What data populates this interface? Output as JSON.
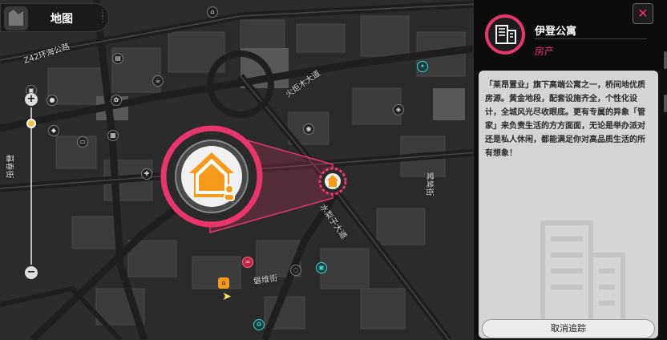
{
  "header": {
    "title": "地图"
  },
  "streets": [
    {
      "name": "Z42环海公路"
    },
    {
      "name": "火炬木大道"
    },
    {
      "name": "水梨子大道"
    },
    {
      "name": "磐维街"
    },
    {
      "name": "鹭鸶街"
    },
    {
      "name": "暮春街"
    }
  ],
  "selected_marker": {
    "icon": "house-icon",
    "accent": "#e8356c",
    "fill": "#f79a1b"
  },
  "panel": {
    "name": "伊登公寓",
    "category": "房产",
    "description": "「莱昂置业」旗下高端公寓之一，桥间地优质房源。黄金地段，配套设施齐全，个性化设计，全城风光尽收眼底。更有专属的异象「管家」来负责生活的方方面面，无论是举办派对还是私人休闲，都能满足你对高品质生活的所有想象！",
    "cancel_label": "取消追踪",
    "close_label": "✕"
  },
  "zoom": {
    "plus": "+",
    "minus": "−",
    "level": 0.1
  },
  "colors": {
    "accent": "#e8356c",
    "marker": "#f79a1b",
    "card": "#d4d4d4"
  }
}
